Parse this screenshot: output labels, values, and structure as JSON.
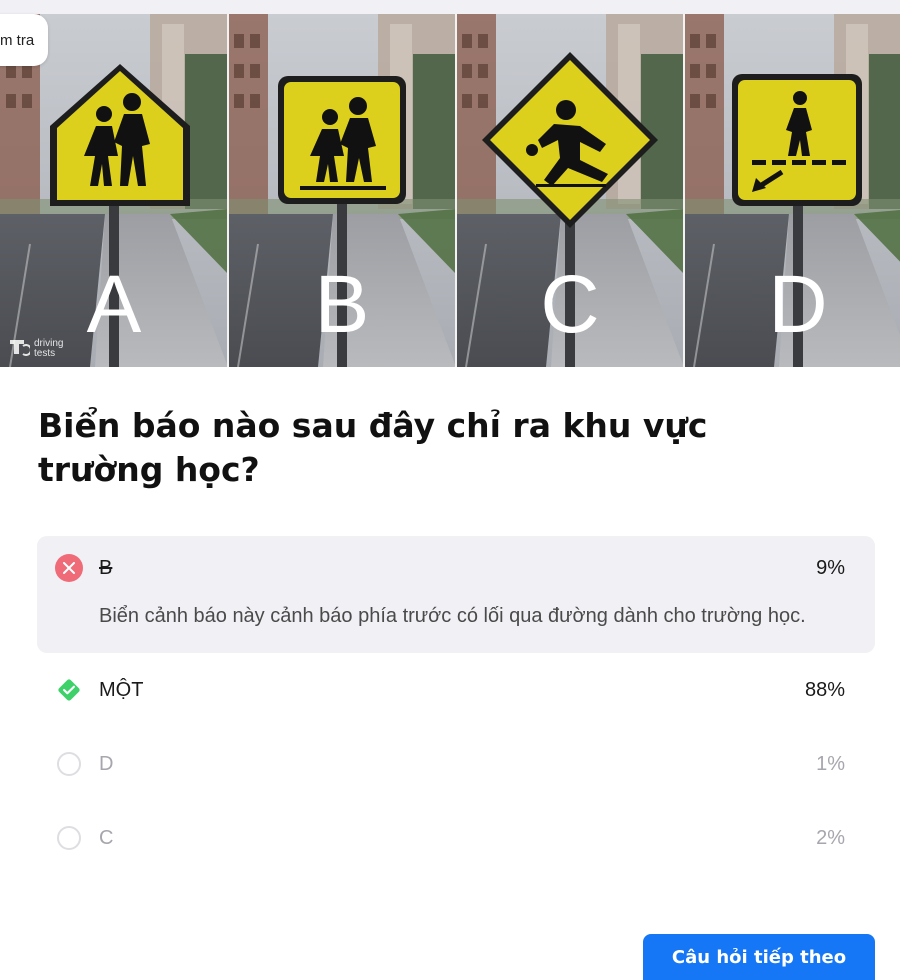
{
  "header": {
    "check_button_label": "m tra"
  },
  "image": {
    "panels": [
      {
        "letter": "A",
        "sign": "pentagon-school-children-sign"
      },
      {
        "letter": "B",
        "sign": "square-school-children-sign"
      },
      {
        "letter": "C",
        "sign": "diamond-children-playing-sign"
      },
      {
        "letter": "D",
        "sign": "square-pedestrian-crossing-sign"
      }
    ],
    "watermark": [
      "driving",
      "tests"
    ]
  },
  "question": {
    "text": "Biển báo nào sau đây chỉ ra khu vực trường học?"
  },
  "answers": [
    {
      "label": "B",
      "percent": "9%",
      "state": "selected-wrong",
      "explanation": "Biển cảnh báo này cảnh báo phía trước có lối qua đường dành cho trường học."
    },
    {
      "label": "MỘT",
      "percent": "88%",
      "state": "correct"
    },
    {
      "label": "D",
      "percent": "1%",
      "state": "neutral"
    },
    {
      "label": "C",
      "percent": "2%",
      "state": "neutral"
    }
  ],
  "footer": {
    "next_button_label": "Câu hỏi tiếp theo"
  },
  "colors": {
    "accent_blue": "#1677f6",
    "wrong_red": "#ef6b78",
    "correct_green": "#3ed16a",
    "sign_yellow": "#e3d21a",
    "selected_bg": "#f0f0f5"
  }
}
